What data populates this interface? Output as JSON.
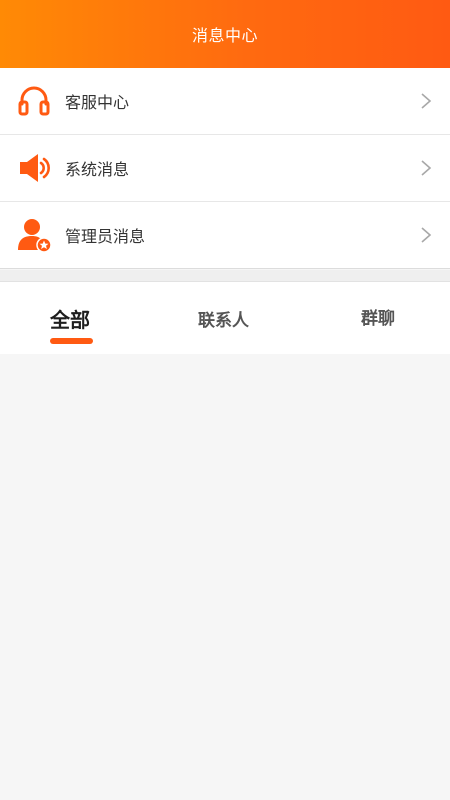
{
  "header": {
    "title": "消息中心"
  },
  "menu": {
    "items": [
      {
        "label": "客服中心",
        "icon": "headset-icon"
      },
      {
        "label": "系统消息",
        "icon": "speaker-icon"
      },
      {
        "label": "管理员消息",
        "icon": "admin-user-icon"
      }
    ]
  },
  "tabs": {
    "items": [
      {
        "label": "全部",
        "active": true
      },
      {
        "label": "联系人",
        "active": false
      },
      {
        "label": "群聊",
        "active": false
      }
    ]
  },
  "colors": {
    "accent": "#ff5a12",
    "header_start": "#ff8a05",
    "header_end": "#ff5a12",
    "background": "#f6f6f6"
  }
}
